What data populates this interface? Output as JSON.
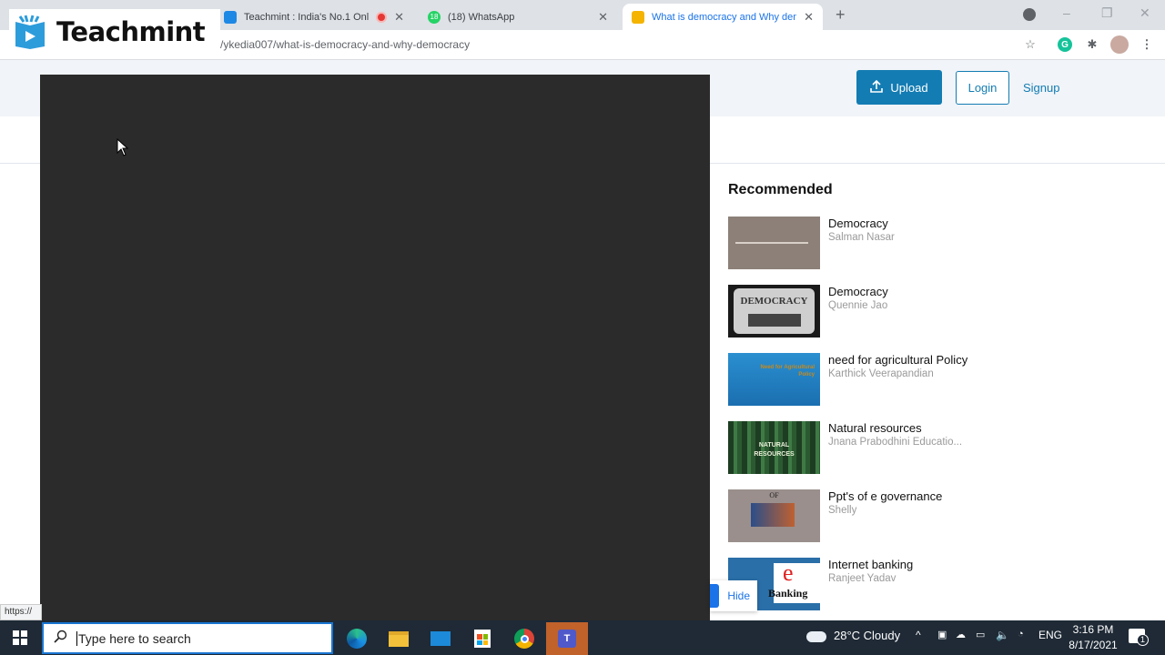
{
  "browser": {
    "tabs": [
      {
        "title": "Teachmint : India's No.1 Onli",
        "recording": true,
        "favicon_color": "#1e88e5"
      },
      {
        "title": "(18) WhatsApp",
        "favicon_color": "#25d366",
        "badge": "18"
      },
      {
        "title": "What is democracy and Why dem",
        "active": true,
        "favicon_color": "#f4b400"
      }
    ],
    "new_tab": "+",
    "url": "/ykedia007/what-is-democracy-and-why-democracy",
    "window_controls": {
      "minimize": "–",
      "restore": "❐",
      "close": "✕"
    }
  },
  "logo": {
    "text": "Teachmint"
  },
  "header": {
    "upload_label": "Upload",
    "login_label": "Login",
    "signup_label": "Signup"
  },
  "recommended": {
    "title": "Recommended",
    "items": [
      {
        "title": "Democracy",
        "author": "Salman Nasar"
      },
      {
        "title": "Democracy",
        "author": "Quennie Jao",
        "thumb_text": "DEMOCRACY"
      },
      {
        "title": "need for agricultural Policy",
        "author": "Karthick Veerapandian",
        "thumb_text": "Need for Agricultural Policy"
      },
      {
        "title": "Natural resources",
        "author": "Jnana Prabodhini Educatio...",
        "thumb_text": "NATURAL RESOURCES"
      },
      {
        "title": "Ppt's of e governance",
        "author": "Shelly",
        "thumb_text": "OF"
      },
      {
        "title": "Internet banking",
        "author": "Ranjeet Yadav",
        "thumb_text": "Banking"
      }
    ]
  },
  "hide_label": "Hide",
  "status_url": "https://",
  "taskbar": {
    "search_placeholder": "Type here to search",
    "weather": "28°C  Cloudy",
    "language": "ENG",
    "time": "3:16 PM",
    "date": "8/17/2021",
    "notification_count": "1"
  }
}
